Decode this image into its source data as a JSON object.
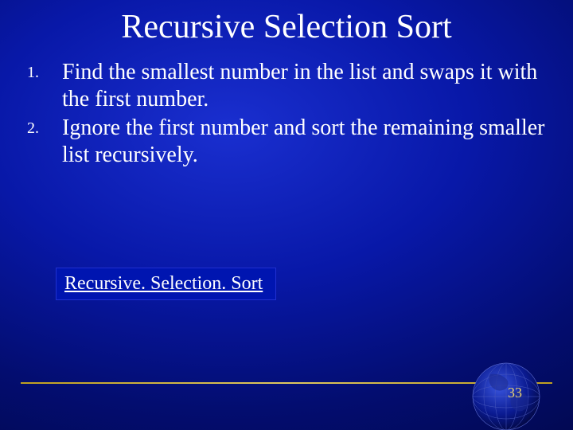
{
  "title": "Recursive Selection Sort",
  "items": [
    {
      "num": "1.",
      "text": "Find the smallest number in the list and swaps it with the first number."
    },
    {
      "num": "2.",
      "text": "Ignore the first number and sort the remaining smaller list recursively."
    }
  ],
  "link_label": "Recursive. Selection. Sort",
  "page_number": "33"
}
